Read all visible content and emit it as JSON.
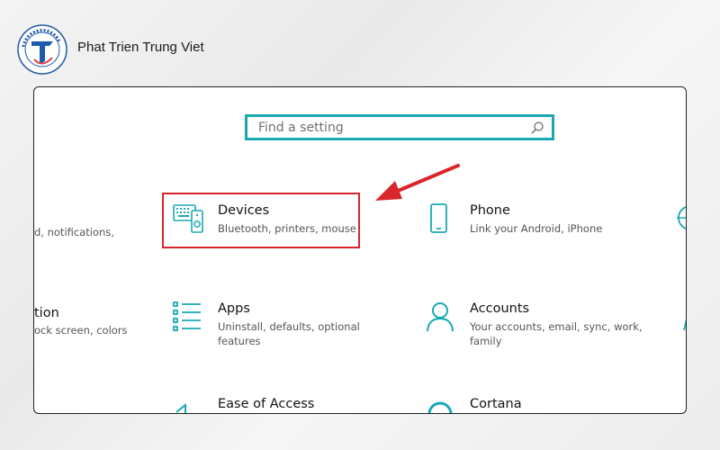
{
  "brand": {
    "name": "Phat Trien Trung Viet",
    "logo_ring_text": "PHAT TRIEN TRUNG VIET"
  },
  "search": {
    "placeholder": "Find a setting"
  },
  "colors": {
    "accent": "#1aa9b4",
    "highlight": "#d9262c"
  },
  "settings": {
    "devices": {
      "icon": "devices-icon",
      "name": "Devices",
      "desc": "Bluetooth, printers, mouse"
    },
    "phone": {
      "icon": "phone-icon",
      "name": "Phone",
      "desc": "Link your Android, iPhone"
    },
    "apps": {
      "icon": "apps-icon",
      "name": "Apps",
      "desc": "Uninstall, defaults, optional features"
    },
    "accounts": {
      "icon": "accounts-icon",
      "name": "Accounts",
      "desc": "Your accounts, email, sync, work, family"
    },
    "ease": {
      "icon": "ease-of-access-icon",
      "name": "Ease of Access"
    },
    "cortana": {
      "icon": "cortana-icon",
      "name": "Cortana"
    }
  },
  "left_partials": {
    "system_desc": "d, notifications,",
    "personalization_name": "tion",
    "personalization_desc": "ock screen, colors"
  }
}
